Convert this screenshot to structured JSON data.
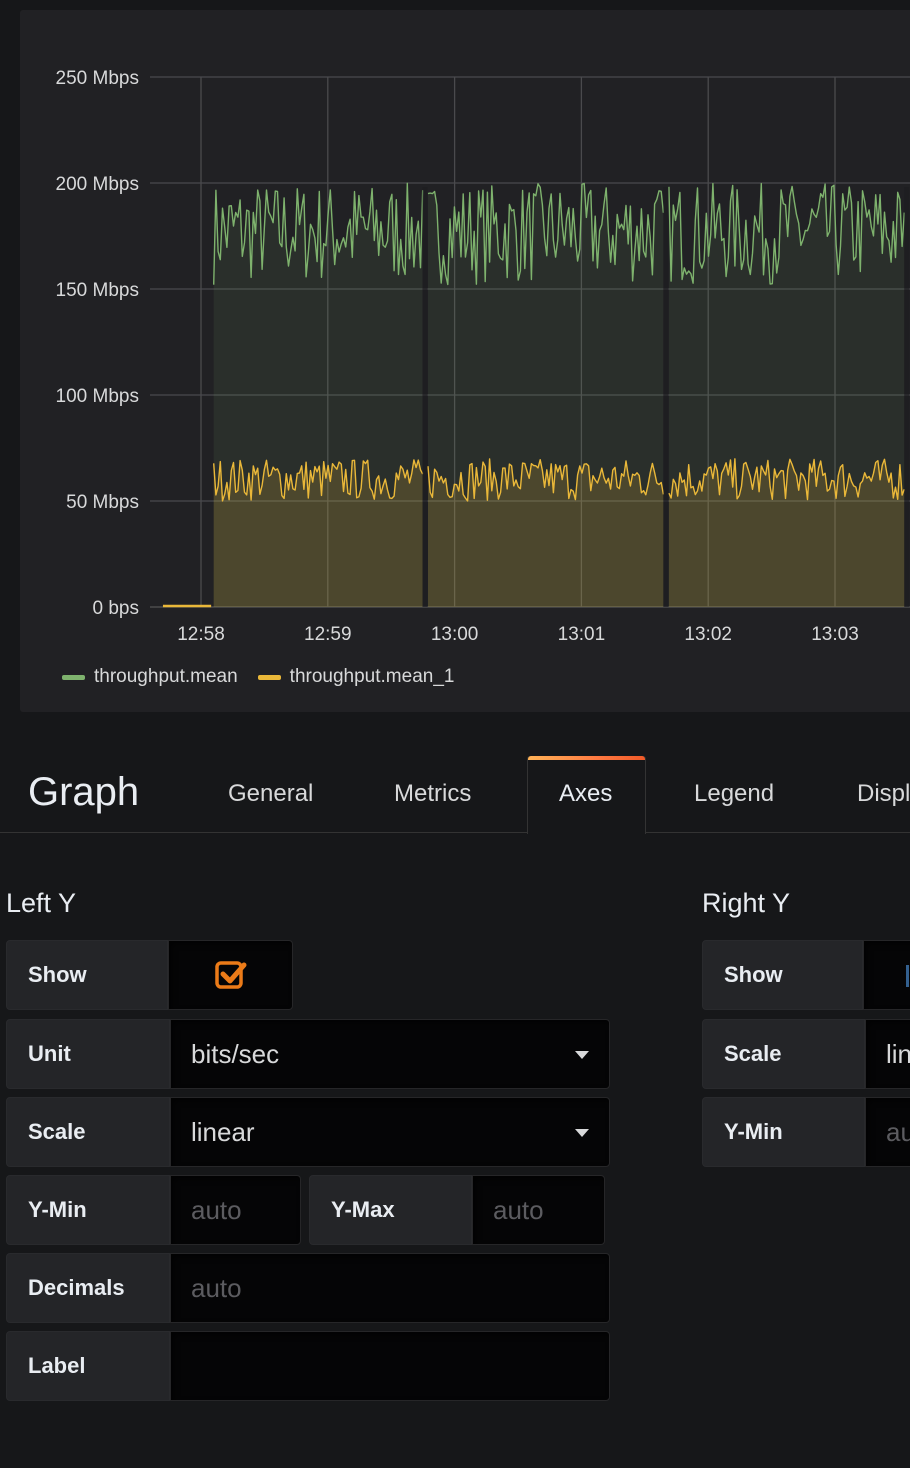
{
  "panel": {
    "legend": [
      {
        "label": "throughput.mean",
        "color": "#7eb26d"
      },
      {
        "label": "throughput.mean_1",
        "color": "#eab839"
      }
    ]
  },
  "chart_data": {
    "type": "area",
    "title": "",
    "xlabel": "",
    "ylabel": "",
    "ylim": [
      0,
      250
    ],
    "y_unit": "Mbps",
    "y_ticks": [
      {
        "value": 0,
        "label": "0 bps"
      },
      {
        "value": 50,
        "label": "50 Mbps"
      },
      {
        "value": 100,
        "label": "100 Mbps"
      },
      {
        "value": 150,
        "label": "150 Mbps"
      },
      {
        "value": 200,
        "label": "200 Mbps"
      },
      {
        "value": 250,
        "label": "250 Mbps"
      }
    ],
    "x_ticks": [
      "12:58",
      "12:59",
      "13:00",
      "13:01",
      "13:02",
      "13:03"
    ],
    "x_range_minutes": [
      -0.4,
      5.6
    ],
    "grid": true,
    "legend_position": "bottom-left",
    "series": [
      {
        "name": "throughput.mean",
        "color": "#7eb26d",
        "fill": true,
        "start_minute": 0.1,
        "end_minute": 5.6,
        "approx_min": 152,
        "approx_max": 200,
        "approx_mean": 175,
        "gaps_at_minutes": [
          1.77,
          3.67,
          5.57
        ]
      },
      {
        "name": "throughput.mean_1",
        "color": "#eab839",
        "fill": true,
        "start_minute": 0.1,
        "end_minute": 5.6,
        "approx_min": 50,
        "approx_max": 70,
        "approx_mean": 60,
        "gaps_at_minutes": [
          1.77,
          3.67,
          5.57
        ],
        "initial_zero_segment": [
          -0.3,
          0.08
        ]
      }
    ]
  },
  "editor": {
    "title": "Graph",
    "tabs": [
      {
        "label": "General",
        "active": false
      },
      {
        "label": "Metrics",
        "active": false
      },
      {
        "label": "Axes",
        "active": true
      },
      {
        "label": "Legend",
        "active": false
      },
      {
        "label": "Displ",
        "active": false
      }
    ],
    "left_y": {
      "title": "Left Y",
      "show_label": "Show",
      "show_checked": true,
      "unit_label": "Unit",
      "unit_value": "bits/sec",
      "scale_label": "Scale",
      "scale_value": "linear",
      "ymin_label": "Y-Min",
      "ymin_placeholder": "auto",
      "ymax_label": "Y-Max",
      "ymax_placeholder": "auto",
      "decimals_label": "Decimals",
      "decimals_placeholder": "auto",
      "label_label": "Label",
      "label_value": ""
    },
    "right_y": {
      "title": "Right Y",
      "show_label": "Show",
      "scale_label": "Scale",
      "scale_value": "lin",
      "ymin_label": "Y-Min",
      "ymin_placeholder": "au"
    },
    "accent_color": "#eb7b18"
  }
}
